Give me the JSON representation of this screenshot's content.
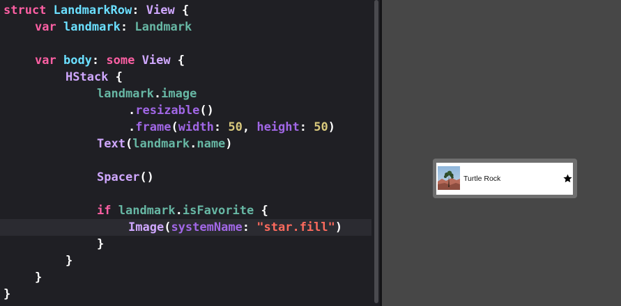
{
  "editor": {
    "lines": [
      [
        {
          "t": "struct",
          "c": "kw"
        },
        {
          "t": " ",
          "c": "pl"
        },
        {
          "t": "LandmarkRow",
          "c": "idn"
        },
        {
          "t": ": ",
          "c": "pl"
        },
        {
          "t": "View",
          "c": "typ"
        },
        {
          "t": " {",
          "c": "pl"
        }
      ],
      [
        {
          "t": "var",
          "c": "kw"
        },
        {
          "t": " ",
          "c": "pl"
        },
        {
          "t": "landmark",
          "c": "idn"
        },
        {
          "t": ": ",
          "c": "pl"
        },
        {
          "t": "Landmark",
          "c": "mem"
        }
      ],
      [],
      [
        {
          "t": "var",
          "c": "kw"
        },
        {
          "t": " ",
          "c": "pl"
        },
        {
          "t": "body",
          "c": "idn"
        },
        {
          "t": ": ",
          "c": "pl"
        },
        {
          "t": "some",
          "c": "kw"
        },
        {
          "t": " ",
          "c": "pl"
        },
        {
          "t": "View",
          "c": "typ"
        },
        {
          "t": " {",
          "c": "pl"
        }
      ],
      [
        {
          "t": "HStack",
          "c": "typ"
        },
        {
          "t": " {",
          "c": "pl"
        }
      ],
      [
        {
          "t": "landmark",
          "c": "mem"
        },
        {
          "t": ".",
          "c": "pl"
        },
        {
          "t": "image",
          "c": "mem"
        }
      ],
      [
        {
          "t": ".",
          "c": "pl"
        },
        {
          "t": "resizable",
          "c": "fn"
        },
        {
          "t": "()",
          "c": "pl"
        }
      ],
      [
        {
          "t": ".",
          "c": "pl"
        },
        {
          "t": "frame",
          "c": "fn"
        },
        {
          "t": "(",
          "c": "pl"
        },
        {
          "t": "width",
          "c": "fn"
        },
        {
          "t": ": ",
          "c": "pl"
        },
        {
          "t": "50",
          "c": "num"
        },
        {
          "t": ", ",
          "c": "pl"
        },
        {
          "t": "height",
          "c": "fn"
        },
        {
          "t": ": ",
          "c": "pl"
        },
        {
          "t": "50",
          "c": "num"
        },
        {
          "t": ")",
          "c": "pl"
        }
      ],
      [
        {
          "t": "Text",
          "c": "typ"
        },
        {
          "t": "(",
          "c": "pl"
        },
        {
          "t": "landmark",
          "c": "mem"
        },
        {
          "t": ".",
          "c": "pl"
        },
        {
          "t": "name",
          "c": "mem"
        },
        {
          "t": ")",
          "c": "pl"
        }
      ],
      [],
      [
        {
          "t": "Spacer",
          "c": "typ"
        },
        {
          "t": "()",
          "c": "pl"
        }
      ],
      [],
      [
        {
          "t": "if",
          "c": "kw"
        },
        {
          "t": " ",
          "c": "pl"
        },
        {
          "t": "landmark",
          "c": "mem"
        },
        {
          "t": ".",
          "c": "pl"
        },
        {
          "t": "isFavorite",
          "c": "mem"
        },
        {
          "t": " {",
          "c": "pl"
        }
      ],
      [
        {
          "t": "Image",
          "c": "typ"
        },
        {
          "t": "(",
          "c": "pl"
        },
        {
          "t": "systemName",
          "c": "fn"
        },
        {
          "t": ": ",
          "c": "pl"
        },
        {
          "t": "\"star.fill\"",
          "c": "str"
        },
        {
          "t": ")",
          "c": "pl"
        }
      ],
      [
        {
          "t": "}",
          "c": "pl"
        }
      ],
      [
        {
          "t": "}",
          "c": "pl"
        }
      ],
      [
        {
          "t": "}",
          "c": "pl"
        }
      ],
      [
        {
          "t": "}",
          "c": "pl"
        }
      ]
    ],
    "current_line": 13
  },
  "preview": {
    "row_name": "Turtle Rock",
    "thumbnail_icon": "landmark-photo-thumbnail",
    "favorite_icon": "star-fill-icon"
  },
  "colors": {
    "editor_background": "#1f1f24",
    "canvas_background": "#474747",
    "keyword": "#fc5fa3",
    "type": "#d0a8ff",
    "identifier": "#6bdfff",
    "member": "#67b7a4",
    "function": "#a167e6",
    "number": "#d9c97c",
    "string": "#fc6a5d"
  }
}
